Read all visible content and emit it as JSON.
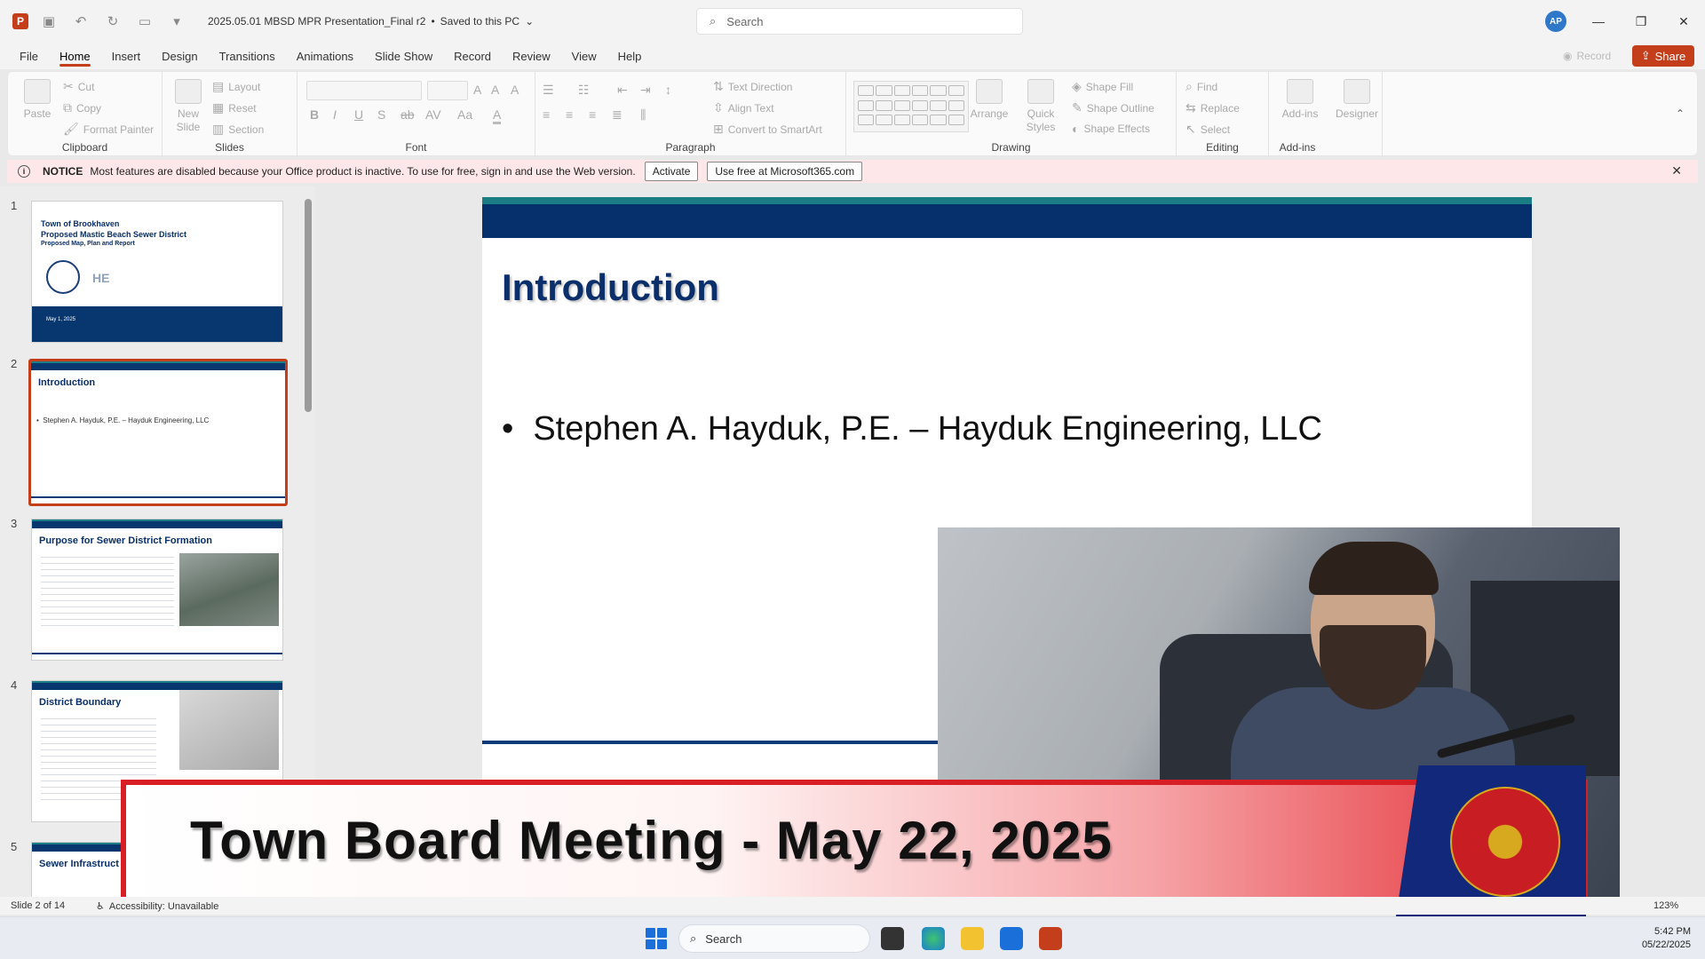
{
  "titlebar": {
    "doc_title": "2025.05.01 MBSD MPR Presentation_Final r2",
    "save_status": "Saved to this PC",
    "search_placeholder": "Search",
    "user_initials": "AP",
    "app_letter": "P"
  },
  "menu": {
    "tabs": [
      "File",
      "Home",
      "Insert",
      "Design",
      "Transitions",
      "Animations",
      "Slide Show",
      "Record",
      "Review",
      "View",
      "Help"
    ],
    "active": "Home",
    "record_label": "Record",
    "share_label": "Share"
  },
  "ribbon": {
    "clipboard": {
      "label": "Clipboard",
      "paste": "Paste",
      "cut": "Cut",
      "copy": "Copy",
      "format_painter": "Format Painter"
    },
    "slides": {
      "label": "Slides",
      "new_slide": "New Slide",
      "layout": "Layout",
      "reset": "Reset",
      "section": "Section"
    },
    "font": {
      "label": "Font"
    },
    "paragraph": {
      "label": "Paragraph",
      "text_direction": "Text Direction",
      "align_text": "Align Text",
      "convert_smartart": "Convert to SmartArt"
    },
    "drawing": {
      "label": "Drawing",
      "arrange": "Arrange",
      "quick_styles": "Quick Styles",
      "shape_fill": "Shape Fill",
      "shape_outline": "Shape Outline",
      "shape_effects": "Shape Effects"
    },
    "editing": {
      "label": "Editing",
      "find": "Find",
      "replace": "Replace",
      "select": "Select"
    },
    "addins": {
      "label": "Add-ins",
      "addins_btn": "Add-ins",
      "designer": "Designer"
    }
  },
  "notice": {
    "title": "NOTICE",
    "message": "Most features are disabled because your Office product is inactive. To use for free, sign in and use the Web version.",
    "activate": "Activate",
    "use_free": "Use free at Microsoft365.com"
  },
  "thumbnails": [
    {
      "num": "1",
      "title_lines": [
        "Town of Brookhaven",
        "Proposed Mastic Beach Sewer District",
        "Proposed Map, Plan and Report"
      ],
      "date": "May 1, 2025"
    },
    {
      "num": "2",
      "title": "Introduction",
      "bullet": "Stephen A. Hayduk, P.E. – Hayduk Engineering, LLC"
    },
    {
      "num": "3",
      "title": "Purpose for Sewer District Formation"
    },
    {
      "num": "4",
      "title": "District Boundary"
    },
    {
      "num": "5",
      "title": "Sewer Infrastruct"
    }
  ],
  "slide": {
    "title": "Introduction",
    "bullet": "Stephen A. Hayduk, P.E. – Hayduk Engineering, LLC"
  },
  "banner": {
    "text": "Town Board Meeting - May 22, 2025"
  },
  "status": {
    "slide_info": "Slide 2 of 14",
    "accessibility": "Accessibility: Unavailable",
    "zoom": "123%"
  },
  "taskbar": {
    "search": "Search",
    "time": "5:42 PM",
    "date": "05/22/2025"
  },
  "colors": {
    "accent": "#c43e1c",
    "slide_navy": "#05306b",
    "slide_teal": "#1a7d84",
    "banner_red": "#d81f26"
  }
}
